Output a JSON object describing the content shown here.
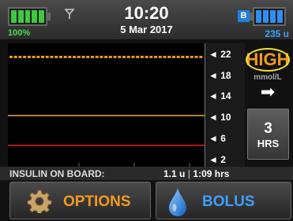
{
  "status": {
    "battery_percent": "100%",
    "battery_level": 1.0,
    "time": "10:20",
    "date": "5 Mar 2017",
    "bluetooth_letter": "B",
    "reservoir_units": "235 u",
    "reservoir_level": 1.0
  },
  "chart_data": {
    "type": "line",
    "y_ticks": [
      "22",
      "18",
      "14",
      "10",
      "6",
      "2"
    ],
    "ylim": [
      0,
      24
    ],
    "high_threshold": 10,
    "low_threshold": 3.9,
    "readings_series": [
      22,
      22,
      22,
      22,
      22,
      22,
      22,
      22,
      22,
      22,
      22,
      22,
      22,
      22,
      22,
      22,
      22,
      22,
      22,
      22,
      22,
      22,
      22,
      22,
      22,
      22,
      22,
      22,
      22,
      22,
      22,
      22,
      22,
      22,
      22,
      22,
      22,
      22,
      22,
      22,
      22,
      22,
      22
    ],
    "colors": {
      "readings": "#f29a1f",
      "high": "#f2a63a",
      "low": "#e02020"
    }
  },
  "bg": {
    "value": "HIGH",
    "unit": "mmol/L",
    "trend": "➡"
  },
  "hours_button": {
    "number": "3",
    "label": "HRS"
  },
  "iob": {
    "label": "INSULIN ON BOARD:",
    "units": "1.1 u",
    "separator": "|",
    "time": "1:09 hrs"
  },
  "buttons": {
    "options": "OPTIONS",
    "bolus": "BOLUS"
  },
  "colors": {
    "accent_orange": "#f29a1f",
    "accent_blue": "#3fa0ff"
  }
}
